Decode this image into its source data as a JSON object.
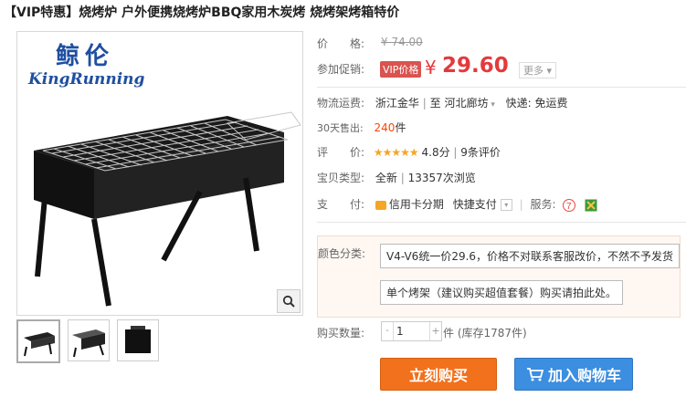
{
  "title": "【VIP特惠】烧烤炉 户外便携烧烤炉BBQ家用木炭烤 烧烤架烤箱特价",
  "image": {
    "brand_cn": "鲸伦",
    "brand_en": "KingRunning",
    "zoom_icon": "magnifier-icon",
    "thumbnails": [
      {
        "icon": "grill-open-thumbnail"
      },
      {
        "icon": "grill-angled-thumbnail"
      },
      {
        "icon": "grill-box-thumbnail"
      }
    ]
  },
  "price": {
    "label": "价　　格:",
    "original": "¥ 74.00"
  },
  "promo": {
    "label": "参加促销:",
    "tag": "VIP价格",
    "currency": "¥",
    "price": "29.60",
    "more": "更多"
  },
  "shipping": {
    "label": "物流运费:",
    "from": "浙江金华",
    "sep": "至",
    "to": "河北廊坊",
    "method": "快递: 免运费"
  },
  "sales": {
    "label": "30天售出:",
    "value": "240",
    "unit": "件"
  },
  "rating": {
    "label": "评　　价:",
    "stars": "★★★★★",
    "score": "4.8分",
    "reviews": "9条评价"
  },
  "condition": {
    "label": "宝贝类型:",
    "value": "全新",
    "views": "13357次浏览"
  },
  "payment": {
    "label": "支　　付:",
    "credit": "信用卡分期",
    "quick": "快捷支付",
    "service_label": "服务:",
    "service1_icon": "seven-day-return-icon",
    "service2_icon": "guarantee-icon"
  },
  "options": {
    "label": "颜色分类:",
    "items": [
      "V4-V6统一价29.6，价格不对联系客服改价，不然不予发货",
      "单个烤架（建议购买超值套餐）购买请拍此处。"
    ]
  },
  "quantity": {
    "label": "购买数量:",
    "value": "1",
    "minus": "-",
    "plus": "+",
    "unit": "件 (库存1787件)"
  },
  "buttons": {
    "buy": "立刻购买",
    "cart": "加入购物车"
  },
  "colors": {
    "price_red": "#e4393c",
    "buy_orange": "#f2711c",
    "cart_blue": "#3c8ee0",
    "brand_blue": "#1f4fa0"
  }
}
